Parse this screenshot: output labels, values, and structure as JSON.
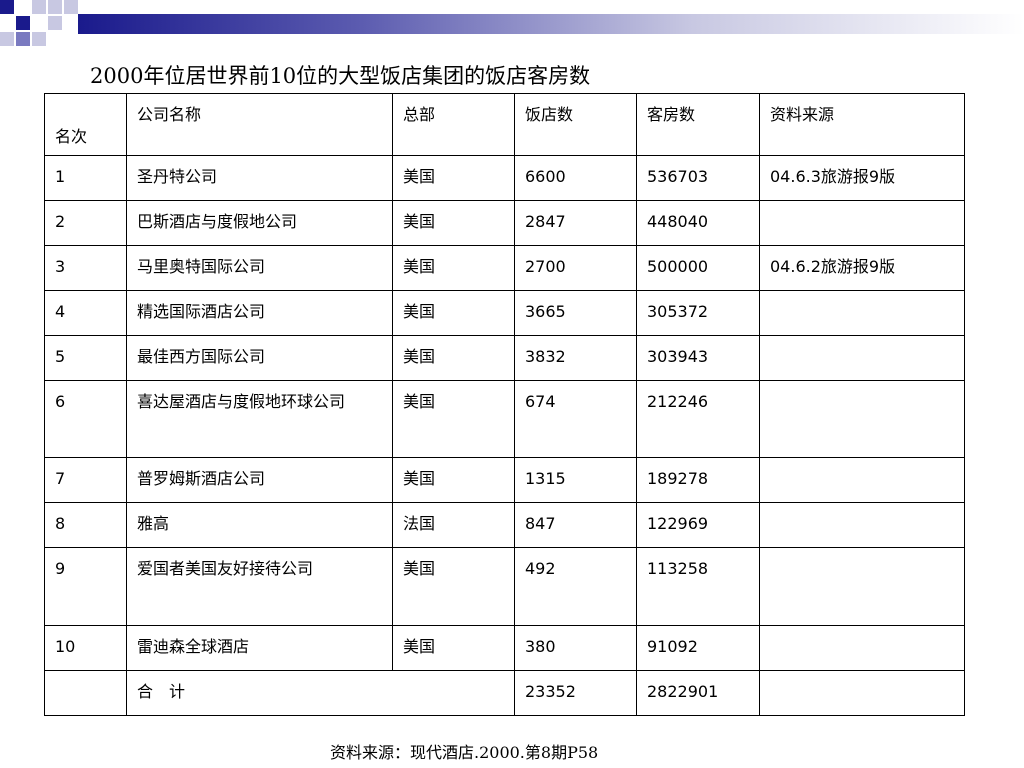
{
  "slide": {
    "title": "2000年位居世界前10位的大型饭店集团的饭店客房数",
    "footer": "资料来源：现代酒店.2000.第8期P58",
    "colors": {
      "deco_dark": "#1a1a8c",
      "deco_mid": "#7a7ac0",
      "deco_light": "#c8c8e2"
    }
  },
  "table": {
    "headers": {
      "rank": "名次",
      "company": "公司名称",
      "hq": "总部",
      "hotels": "饭店数",
      "rooms": "客房数",
      "source": "资料来源"
    },
    "rows": [
      {
        "rank": "1",
        "company": "圣丹特公司",
        "hq": "美国",
        "hotels": "6600",
        "rooms": "536703",
        "source": "04.6.3旅游报9版"
      },
      {
        "rank": "2",
        "company": "巴斯酒店与度假地公司",
        "hq": "美国",
        "hotels": "2847",
        "rooms": "448040",
        "source": ""
      },
      {
        "rank": "3",
        "company": "马里奥特国际公司",
        "hq": "美国",
        "hotels": "2700",
        "rooms": "500000",
        "source": "04.6.2旅游报9版"
      },
      {
        "rank": "4",
        "company": "精选国际酒店公司",
        "hq": "美国",
        "hotels": "3665",
        "rooms": "305372",
        "source": ""
      },
      {
        "rank": "5",
        "company": "最佳西方国际公司",
        "hq": "美国",
        "hotels": "3832",
        "rooms": "303943",
        "source": ""
      },
      {
        "rank": "6",
        "company": "喜达屋酒店与度假地环球公司",
        "hq": "美国",
        "hotels": "674",
        "rooms": "212246",
        "source": ""
      },
      {
        "rank": "7",
        "company": "普罗姆斯酒店公司",
        "hq": "美国",
        "hotels": "1315",
        "rooms": "189278",
        "source": ""
      },
      {
        "rank": "8",
        "company": "雅高",
        "hq": "法国",
        "hotels": "847",
        "rooms": "122969",
        "source": ""
      },
      {
        "rank": "9",
        "company": "爱国者美国友好接待公司",
        "hq": "美国",
        "hotels": "492",
        "rooms": "113258",
        "source": ""
      },
      {
        "rank": "10",
        "company": "雷迪森全球酒店",
        "hq": "美国",
        "hotels": "380",
        "rooms": "91092",
        "source": ""
      }
    ],
    "total": {
      "label": "合　计",
      "hotels": "23352",
      "rooms": "2822901"
    }
  }
}
